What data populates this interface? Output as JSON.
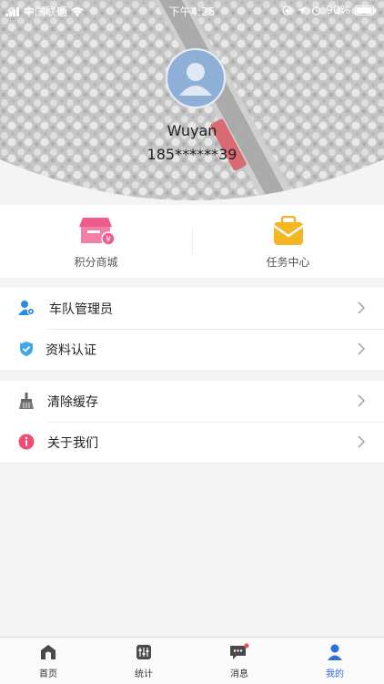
{
  "status_bar": {
    "carrier": "中国联通",
    "time": "下午4:25",
    "battery": "90%"
  },
  "profile": {
    "username": "Wuyan",
    "phone": "185******39"
  },
  "shortcuts": [
    {
      "label": "积分商城",
      "icon": "store-icon",
      "color": "#ef5b8e"
    },
    {
      "label": "任务中心",
      "icon": "task-bag-icon",
      "color": "#f5b623"
    }
  ],
  "menu_group_1": [
    {
      "label": "车队管理员",
      "icon": "fleet-admin-icon"
    },
    {
      "label": "资料认证",
      "icon": "verified-shield-icon"
    }
  ],
  "menu_group_2": [
    {
      "label": "清除缓存",
      "icon": "broom-icon"
    },
    {
      "label": "关于我们",
      "icon": "info-icon"
    }
  ],
  "tabs": [
    {
      "label": "首页",
      "icon": "home-icon"
    },
    {
      "label": "统计",
      "icon": "stats-icon"
    },
    {
      "label": "消息",
      "icon": "message-icon"
    },
    {
      "label": "我的",
      "icon": "profile-icon",
      "active": true
    }
  ],
  "colors": {
    "accent": "#2d6fd6",
    "fleet_icon": "#2b8be0",
    "shield_icon": "#3fa8e6",
    "info_icon": "#f04d73",
    "badge": "#f04d4d"
  }
}
